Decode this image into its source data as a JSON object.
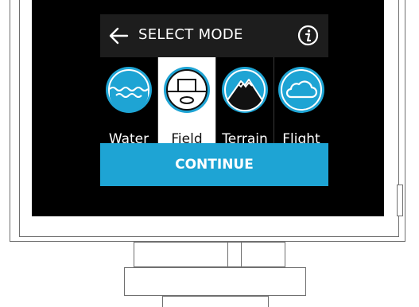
{
  "header": {
    "title": "SELECT MODE",
    "back_icon": "arrow-left-icon",
    "info_icon": "info-circle-icon"
  },
  "modes": [
    {
      "label": "Water",
      "icon": "water-icon",
      "selected": false
    },
    {
      "label": "Field",
      "icon": "field-icon",
      "selected": true
    },
    {
      "label": "Terrain",
      "icon": "terrain-icon",
      "selected": false
    },
    {
      "label": "Flight",
      "icon": "cloud-icon",
      "selected": false
    }
  ],
  "continue_label": "CONTINUE",
  "colors": {
    "accent": "#1ea4d4",
    "screen_background": "#000000",
    "header_background": "#1d1d1d",
    "selected_tile": "#ffffff"
  }
}
